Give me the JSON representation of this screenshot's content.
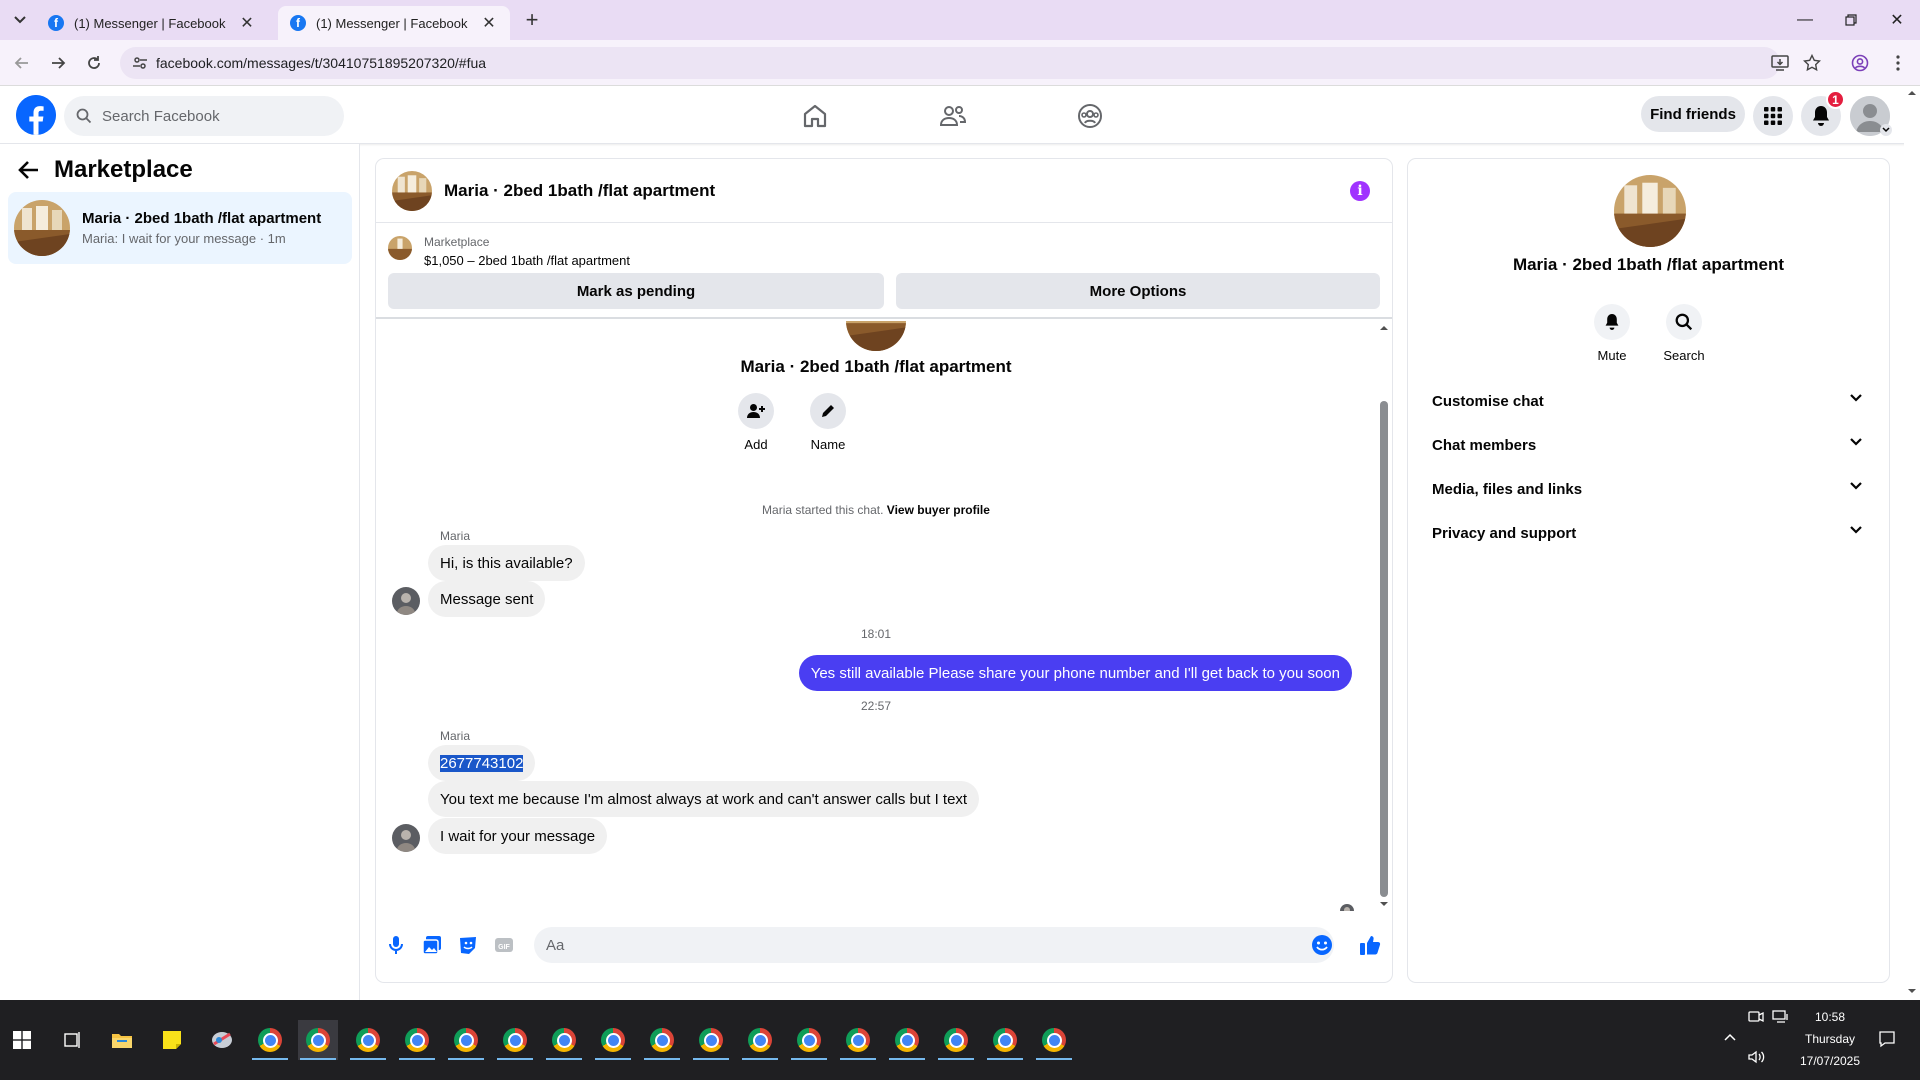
{
  "browser": {
    "tabs": [
      {
        "title": "(1) Messenger | Facebook",
        "active": false
      },
      {
        "title": "(1) Messenger | Facebook",
        "active": true
      }
    ],
    "url": "facebook.com/messages/t/30410751895207320/#fua"
  },
  "fb_header": {
    "search_placeholder": "Search Facebook",
    "find_friends": "Find friends",
    "notification_count": "1"
  },
  "left_panel": {
    "title": "Marketplace",
    "conversation": {
      "name": "Maria · 2bed 1bath /flat apartment",
      "preview": "Maria: I wait for your message · 1m"
    }
  },
  "chat": {
    "title": "Maria · 2bed 1bath /flat apartment",
    "marketplace": {
      "label": "Marketplace",
      "listing": "$1,050 – 2bed 1bath /flat apartment",
      "mark_pending": "Mark as pending",
      "more_options": "More Options"
    },
    "thread_name": "Maria · 2bed 1bath /flat apartment",
    "actions": {
      "add": "Add",
      "name": "Name"
    },
    "system_prefix": "Maria started this chat.",
    "system_link": "View buyer profile",
    "messages": {
      "sender1": "Maria",
      "m1": "Hi, is this available?",
      "m2": "Message sent",
      "time1": "18:01",
      "out1": "Yes still available Please share your phone number and I'll get back to you soon",
      "time2": "22:57",
      "sender2": "Maria",
      "m3": "2677743102",
      "m4": "You text me because I'm almost always at work and can't answer calls but I text",
      "m5": "I wait for your message"
    },
    "composer_placeholder": "Aa"
  },
  "right_panel": {
    "name": "Maria · 2bed 1bath /flat apartment",
    "mute": "Mute",
    "search": "Search",
    "sections": [
      "Customise chat",
      "Chat members",
      "Media, files and links",
      "Privacy and support"
    ]
  },
  "taskbar": {
    "time": "10:58",
    "day": "Thursday",
    "date": "17/07/2025"
  },
  "colors": {
    "fb_blue": "#0866ff",
    "outgoing_bubble": "#4a3ef2",
    "selected_conversation": "#ebf5ff",
    "info_icon": "#a033ff",
    "notification_badge": "#e41e3f"
  }
}
